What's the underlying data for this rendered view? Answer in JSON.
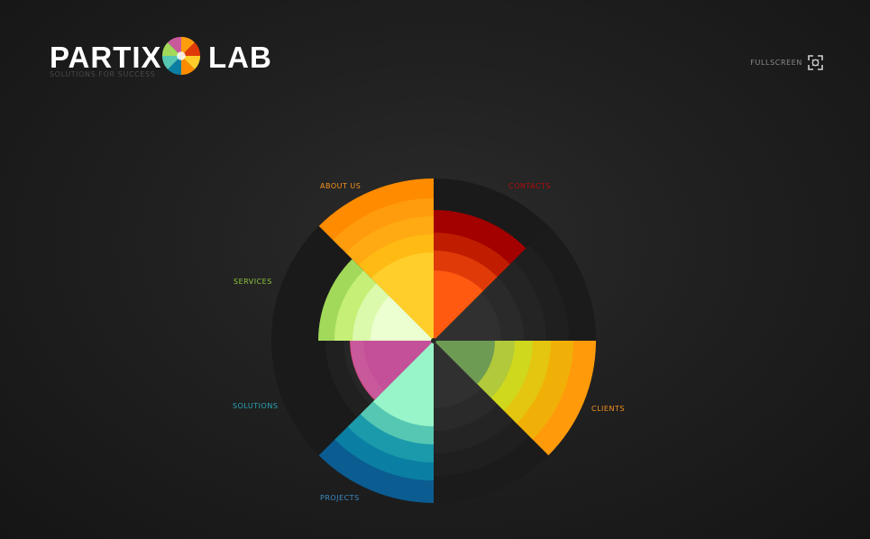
{
  "logo": {
    "word_left": "PARTIX",
    "word_right": "LAB",
    "tagline": "SOLUTIONS FOR SUCCESS",
    "mark_icon": "pinwheel-icon"
  },
  "header": {
    "fullscreen_label": "FULLSCREEN",
    "fullscreen_icon": "fullscreen-icon"
  },
  "colors": {
    "background": "#1e1e1e",
    "ring_dark": "#1a1a1a",
    "ring_mid": "#222222",
    "ring_inner": "#2c2c2c",
    "center": "#353535"
  },
  "menu": [
    {
      "label": "ABOUT US",
      "color": "#f7941d",
      "fill_rings": 5,
      "shades": [
        "#ff8c00",
        "#ff9c0d",
        "#ffaa12",
        "#ffba14",
        "#ffce2b"
      ]
    },
    {
      "label": "CONTACTS",
      "color": "#b30b0b",
      "fill_rings": 4,
      "shades": [
        "#1a1a1a",
        "#a30000",
        "#c01d00",
        "#e03a08",
        "#ff5a10"
      ]
    },
    {
      "label": "CLIENTS",
      "color": "#f7941d",
      "fill_rings": 5,
      "shades": [
        "#ff9a0a",
        "#f1b008",
        "#e4c50f",
        "#cfd81d",
        "#b1c93a"
      ]
    },
    {
      "label": "PROJECTS",
      "color": "#3d8cc4",
      "fill_rings": 5,
      "shades": [
        "#0b5c91",
        "#0a7fa3",
        "#1a9aab",
        "#56c7b2",
        "#98f5c9"
      ]
    },
    {
      "label": "SOLUTIONS",
      "color": "#2aa6b8",
      "fill_rings": 2,
      "shades": [
        "#1a1a1a",
        "#202020",
        "#262626",
        "#d2477e",
        "#c85a9c"
      ]
    },
    {
      "label": "SERVICES",
      "color": "#8dc63f",
      "fill_rings": 4,
      "shades": [
        "#1a1a1a",
        "#a2d95a",
        "#c5ef76",
        "#dcfaac",
        "#ecffd0"
      ]
    }
  ],
  "dark_sectors": [
    {
      "shades": [
        "#1b1b1b",
        "#1f1f1f",
        "#242424",
        "#2a2a2a",
        "#303030"
      ]
    },
    {
      "shades": [
        "#1b1b1b",
        "#1f1f1f",
        "#242424",
        "#2a2a2a",
        "#303030"
      ]
    }
  ],
  "center_overlay": {
    "color": "#6a9955"
  }
}
